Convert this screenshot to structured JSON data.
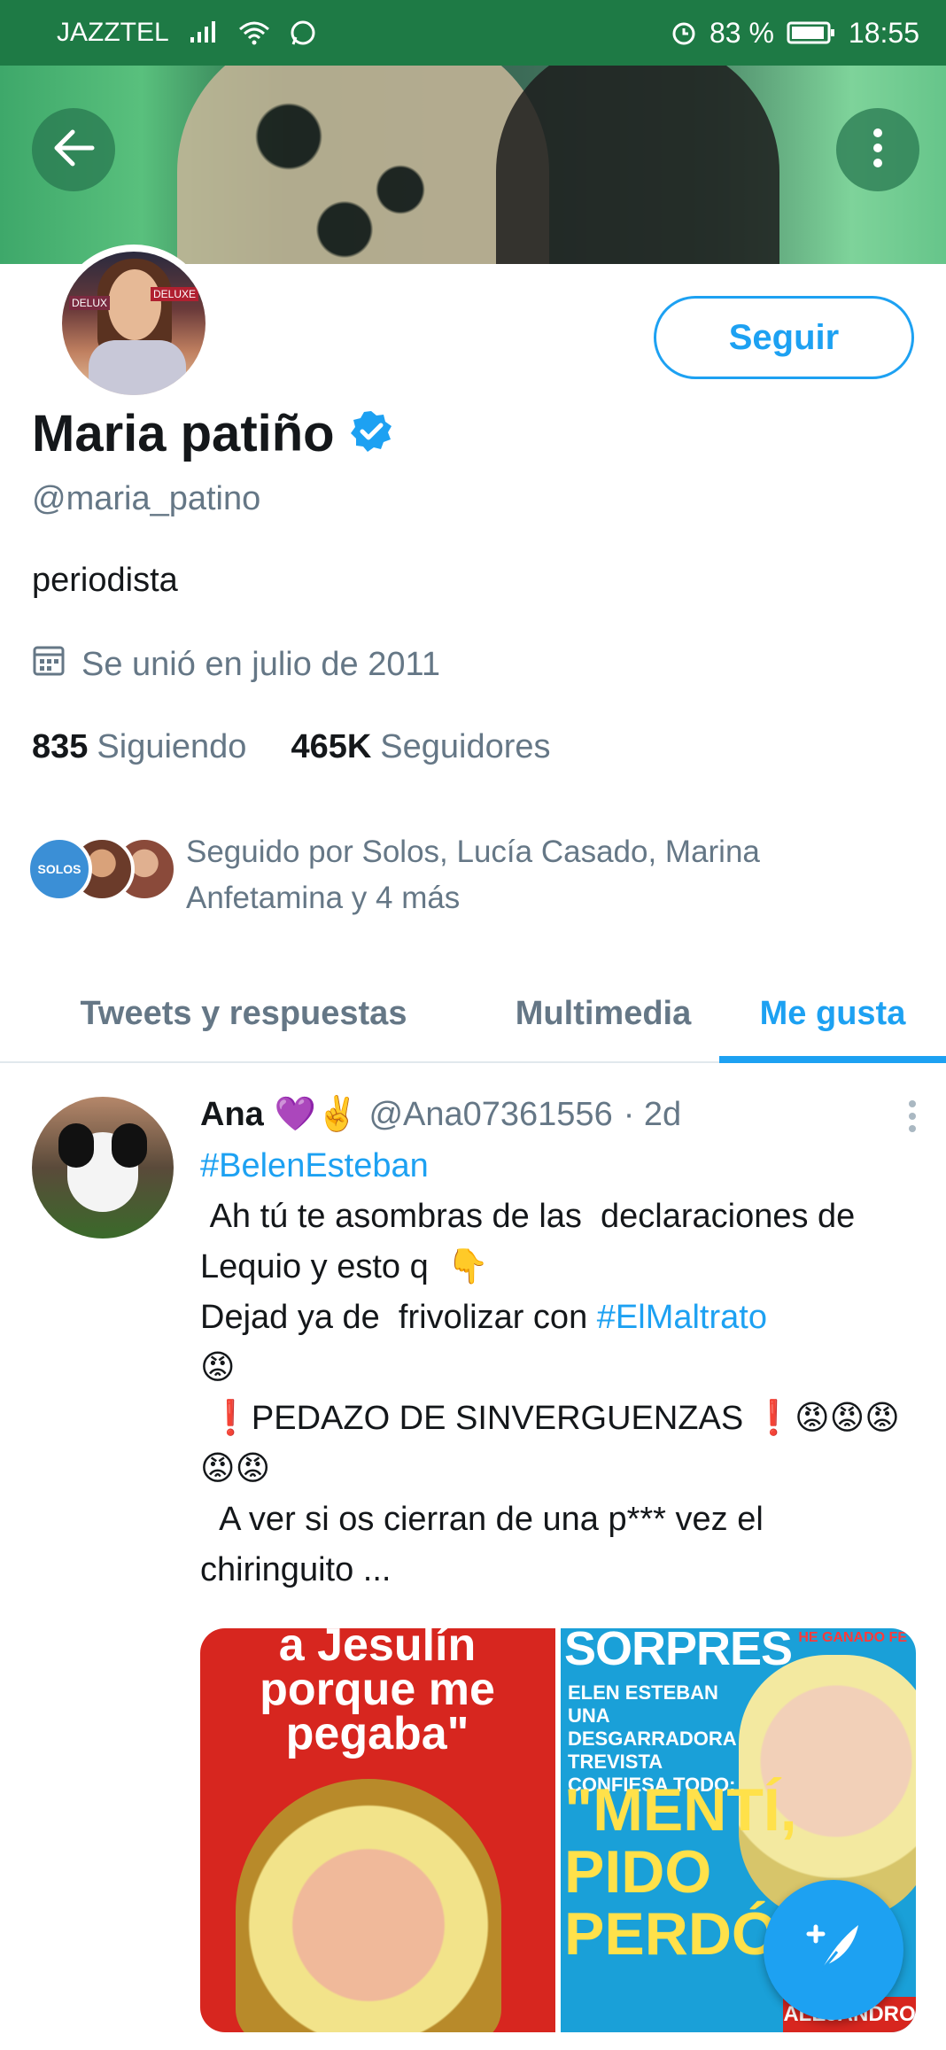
{
  "status_bar": {
    "carrier": "JAZZTEL",
    "battery": "83 %",
    "time": "18:55"
  },
  "header": {
    "back_icon": "arrow-left-icon",
    "more_icon": "more-vertical-icon"
  },
  "profile": {
    "name": "Maria patiño",
    "verified": true,
    "handle": "@maria_patino",
    "bio": "periodista",
    "joined": "Se unió en julio de 2011",
    "following_count": "835",
    "following_label": "Siguiendo",
    "followers_count": "465K",
    "followers_label": "Seguidores",
    "follow_button": "Seguir",
    "followed_by": "Seguido por Solos, Lucía Casado, Marina Anfetamina y 4 más"
  },
  "tabs": [
    {
      "label": "Tweets y respuestas",
      "active": false
    },
    {
      "label": "Multimedia",
      "active": false
    },
    {
      "label": "Me gusta",
      "active": true
    }
  ],
  "tweet": {
    "name": "Ana",
    "emojis": "💜✌️",
    "handle": "@Ana07361556",
    "age": "· 2d",
    "hashtag1": "#BelenEsteban",
    "line1": " Ah tú te asombras de las  declaraciones de Lequio y esto q  👇",
    "line2_pre": "Dejad ya de  frivolizar con ",
    "hashtag2": "#ElMaltrato",
    "line3": "😡",
    "line4": " ❗PEDAZO DE SINVERGUENZAS ❗😡😡😡😡😡",
    "line5": "  A ver si os cierran de una p*** vez el chiringuito ..."
  },
  "media": {
    "left_headline": "a Jesulín porque me pegaba\"",
    "right_title": "SORPRES",
    "right_sub": "ELEN ESTEBAN UNA DESGARRADORA TREVISTA CONFIESA TODO:",
    "right_big": "\"MENTÍ, PIDO PERDÓN\"",
    "right_corner": "HE GANADO FE",
    "right_bottom": "ALEJANDRO"
  },
  "colors": {
    "accent": "#1da1f2",
    "status_bar": "#1e7a45",
    "secondary_text": "#657786"
  }
}
